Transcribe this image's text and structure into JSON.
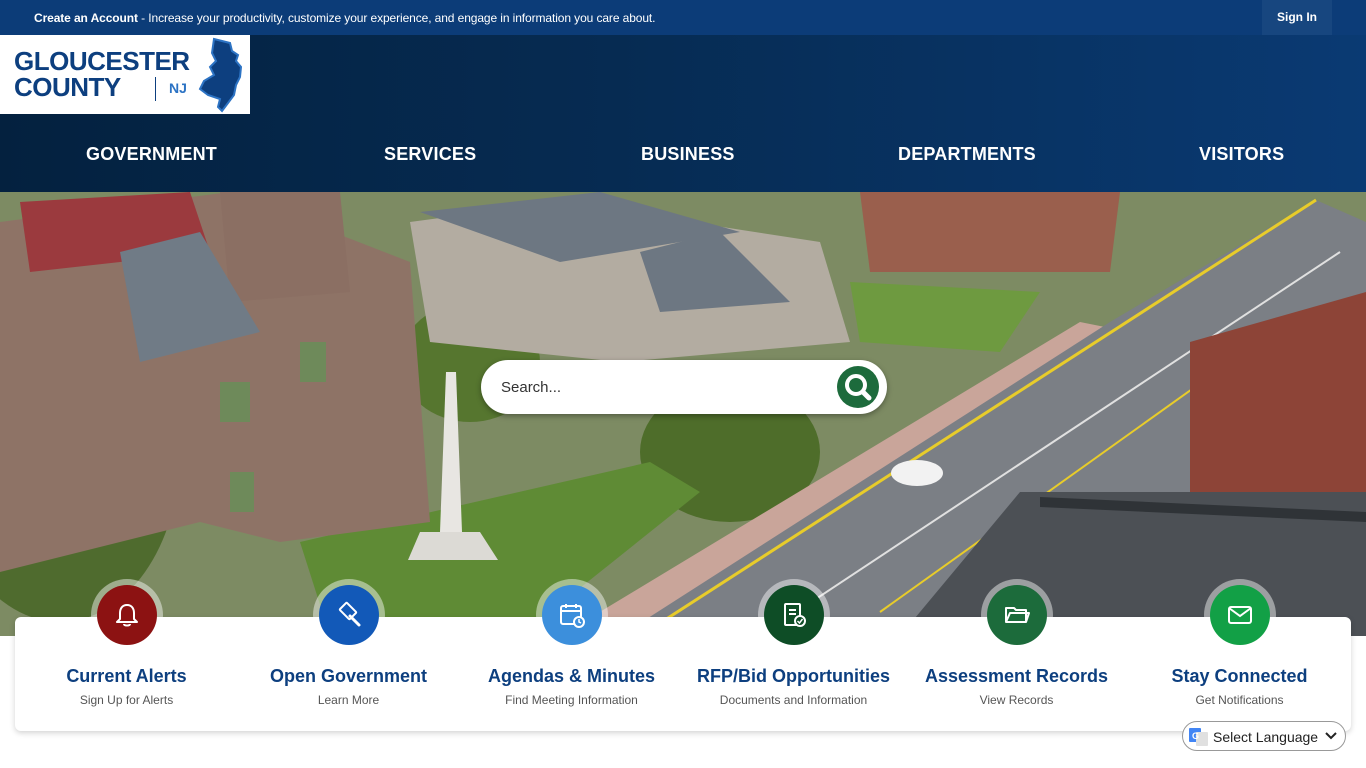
{
  "topbar": {
    "account_link": "Create an Account",
    "account_message": " - Increase your productivity, customize your experience, and engage in information you care about.",
    "signin_label": "Sign In"
  },
  "logo": {
    "line1": "GLOUCESTER",
    "line2": "COUNTY",
    "state": "NJ"
  },
  "nav": {
    "items": [
      {
        "label": "GOVERNMENT"
      },
      {
        "label": "SERVICES"
      },
      {
        "label": "BUSINESS"
      },
      {
        "label": "DEPARTMENTS"
      },
      {
        "label": "VISITORS"
      }
    ]
  },
  "search": {
    "placeholder": "Search..."
  },
  "quick_links": [
    {
      "title": "Current Alerts",
      "subtitle": "Sign Up for Alerts",
      "icon": "bell-icon",
      "color": "#8c1212"
    },
    {
      "title": "Open Government",
      "subtitle": "Learn More",
      "icon": "gavel-icon",
      "color": "#1259b8"
    },
    {
      "title": "Agendas & Minutes",
      "subtitle": "Find Meeting Information",
      "icon": "calendar-clock-icon",
      "color": "#3c8fdc"
    },
    {
      "title": "RFP/Bid Opportunities",
      "subtitle": "Documents and Information",
      "icon": "document-check-icon",
      "color": "#0e4d26"
    },
    {
      "title": "Assessment Records",
      "subtitle": "View Records",
      "icon": "folder-icon",
      "color": "#1c6b3b"
    },
    {
      "title": "Stay Connected",
      "subtitle": "Get Notifications",
      "icon": "envelope-icon",
      "color": "#12a046"
    }
  ],
  "language": {
    "label": "Select Language"
  },
  "colors": {
    "topbar": "#0c3c78",
    "header": "#062b52",
    "brand_blue": "#0d3f7f",
    "search_button": "#1d6b3c"
  }
}
